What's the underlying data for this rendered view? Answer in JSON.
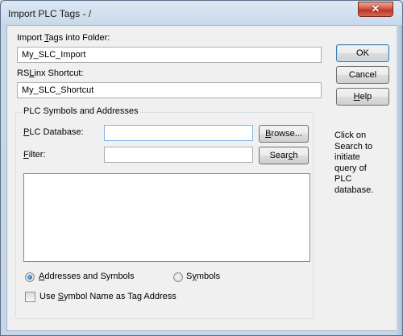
{
  "window": {
    "title": "Import PLC Tags - /",
    "close_icon": "close-icon"
  },
  "import_folder": {
    "label_pre": "Import ",
    "label_u": "T",
    "label_post": "ags into Folder:",
    "value": "My_SLC_Import"
  },
  "shortcut": {
    "label_pre": "RS",
    "label_u": "L",
    "label_post": "inx Shortcut:",
    "value": "My_SLC_Shortcut"
  },
  "buttons": {
    "ok": "OK",
    "cancel": "Cancel",
    "help_u": "H",
    "help_post": "elp"
  },
  "group": {
    "title": "PLC Symbols and Addresses",
    "database_label_u": "P",
    "database_label_post": "LC Database:",
    "database_value": "",
    "browse_u": "B",
    "browse_post": "rowse...",
    "filter_label_u": "F",
    "filter_label_post": "ilter:",
    "filter_value": "",
    "search_pre": "Sear",
    "search_u": "c",
    "search_post": "h",
    "radio_addresses_u": "A",
    "radio_addresses_post": "ddresses and Symbols",
    "radio_symbols_pre": "S",
    "radio_symbols_u": "y",
    "radio_symbols_post": "mbols",
    "selected_radio": "Addresses and Symbols",
    "checkbox_pre": "Use ",
    "checkbox_u": "S",
    "checkbox_post": "ymbol Name as Tag Address",
    "checkbox_checked": false
  },
  "hint_text": "Click on Search to initiate query of PLC database."
}
